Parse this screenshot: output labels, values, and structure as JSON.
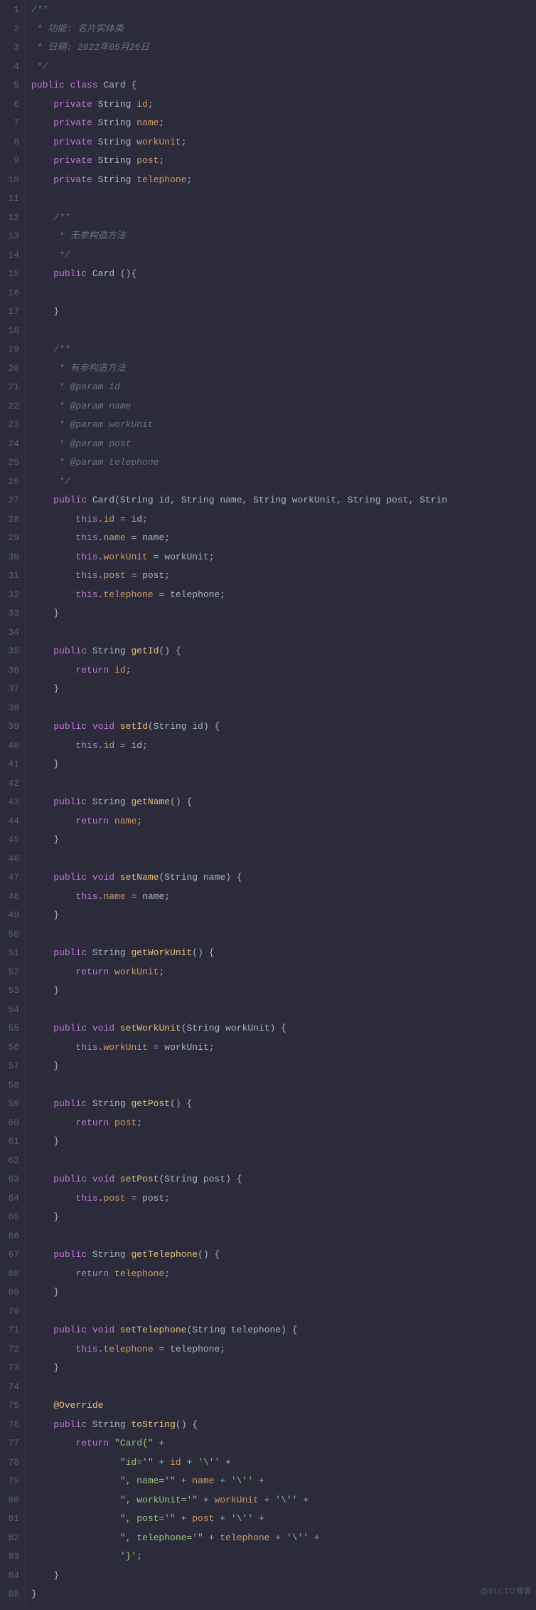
{
  "editor": {
    "gutter_start": 1,
    "gutter_end": 85,
    "watermark": "@51CTO博客",
    "lines": [
      [
        [
          "c",
          "/**"
        ]
      ],
      [
        [
          "c",
          " * 功能: 名片实体类"
        ]
      ],
      [
        [
          "c",
          " * 日期: 2022年05月26日"
        ]
      ],
      [
        [
          "c",
          " */"
        ]
      ],
      [
        [
          "kw",
          "public"
        ],
        [
          "pun",
          " "
        ],
        [
          "kw",
          "class"
        ],
        [
          "pun",
          " "
        ],
        [
          "ty",
          "Card"
        ],
        [
          "pun",
          " {"
        ]
      ],
      [
        [
          "pun",
          "    "
        ],
        [
          "kw",
          "private"
        ],
        [
          "pun",
          " "
        ],
        [
          "ty",
          "String"
        ],
        [
          "pun",
          " "
        ],
        [
          "fld",
          "id"
        ],
        [
          "pun",
          ";"
        ]
      ],
      [
        [
          "pun",
          "    "
        ],
        [
          "kw",
          "private"
        ],
        [
          "pun",
          " "
        ],
        [
          "ty",
          "String"
        ],
        [
          "pun",
          " "
        ],
        [
          "fld",
          "name"
        ],
        [
          "pun",
          ";"
        ]
      ],
      [
        [
          "pun",
          "    "
        ],
        [
          "kw",
          "private"
        ],
        [
          "pun",
          " "
        ],
        [
          "ty",
          "String"
        ],
        [
          "pun",
          " "
        ],
        [
          "fld",
          "workUnit"
        ],
        [
          "pun",
          ";"
        ]
      ],
      [
        [
          "pun",
          "    "
        ],
        [
          "kw",
          "private"
        ],
        [
          "pun",
          " "
        ],
        [
          "ty",
          "String"
        ],
        [
          "pun",
          " "
        ],
        [
          "fld",
          "post"
        ],
        [
          "pun",
          ";"
        ]
      ],
      [
        [
          "pun",
          "    "
        ],
        [
          "kw",
          "private"
        ],
        [
          "pun",
          " "
        ],
        [
          "ty",
          "String"
        ],
        [
          "pun",
          " "
        ],
        [
          "fld",
          "telephone"
        ],
        [
          "pun",
          ";"
        ]
      ],
      [
        [
          "pun",
          ""
        ]
      ],
      [
        [
          "c",
          "    /**"
        ]
      ],
      [
        [
          "c",
          "     * 无参构造方法"
        ]
      ],
      [
        [
          "c",
          "     */"
        ]
      ],
      [
        [
          "pun",
          "    "
        ],
        [
          "kw",
          "public"
        ],
        [
          "pun",
          " "
        ],
        [
          "ty",
          "Card"
        ],
        [
          "pun",
          " (){"
        ]
      ],
      [
        [
          "pun",
          ""
        ]
      ],
      [
        [
          "pun",
          "    }"
        ]
      ],
      [
        [
          "pun",
          ""
        ]
      ],
      [
        [
          "c",
          "    /**"
        ]
      ],
      [
        [
          "c",
          "     * 有参构造方法"
        ]
      ],
      [
        [
          "c",
          "     * @param id"
        ]
      ],
      [
        [
          "c",
          "     * @param name"
        ]
      ],
      [
        [
          "c",
          "     * @param workUnit"
        ]
      ],
      [
        [
          "c",
          "     * @param post"
        ]
      ],
      [
        [
          "c",
          "     * @param telephone"
        ]
      ],
      [
        [
          "c",
          "     */"
        ]
      ],
      [
        [
          "pun",
          "    "
        ],
        [
          "kw",
          "public"
        ],
        [
          "pun",
          " "
        ],
        [
          "ty",
          "Card"
        ],
        [
          "pun",
          "("
        ],
        [
          "ty",
          "String"
        ],
        [
          "pun",
          " id, "
        ],
        [
          "ty",
          "String"
        ],
        [
          "pun",
          " name, "
        ],
        [
          "ty",
          "String"
        ],
        [
          "pun",
          " workUnit, "
        ],
        [
          "ty",
          "String"
        ],
        [
          "pun",
          " post, "
        ],
        [
          "ty",
          "Strin"
        ]
      ],
      [
        [
          "pun",
          "        "
        ],
        [
          "kw",
          "this"
        ],
        [
          "pun",
          "."
        ],
        [
          "fld",
          "id"
        ],
        [
          "pun",
          " = id;"
        ]
      ],
      [
        [
          "pun",
          "        "
        ],
        [
          "kw",
          "this"
        ],
        [
          "pun",
          "."
        ],
        [
          "fld",
          "name"
        ],
        [
          "pun",
          " = name;"
        ]
      ],
      [
        [
          "pun",
          "        "
        ],
        [
          "kw",
          "this"
        ],
        [
          "pun",
          "."
        ],
        [
          "fld",
          "workUnit"
        ],
        [
          "pun",
          " = workUnit;"
        ]
      ],
      [
        [
          "pun",
          "        "
        ],
        [
          "kw",
          "this"
        ],
        [
          "pun",
          "."
        ],
        [
          "fld",
          "post"
        ],
        [
          "pun",
          " = post;"
        ]
      ],
      [
        [
          "pun",
          "        "
        ],
        [
          "kw",
          "this"
        ],
        [
          "pun",
          "."
        ],
        [
          "fld",
          "telephone"
        ],
        [
          "pun",
          " = telephone;"
        ]
      ],
      [
        [
          "pun",
          "    }"
        ]
      ],
      [
        [
          "pun",
          ""
        ]
      ],
      [
        [
          "pun",
          "    "
        ],
        [
          "kw",
          "public"
        ],
        [
          "pun",
          " "
        ],
        [
          "ty",
          "String"
        ],
        [
          "pun",
          " "
        ],
        [
          "fn",
          "getId"
        ],
        [
          "pun",
          "() {"
        ]
      ],
      [
        [
          "pun",
          "        "
        ],
        [
          "kw",
          "return"
        ],
        [
          "pun",
          " "
        ],
        [
          "fld",
          "id"
        ],
        [
          "pun",
          ";"
        ]
      ],
      [
        [
          "pun",
          "    }"
        ]
      ],
      [
        [
          "pun",
          ""
        ]
      ],
      [
        [
          "pun",
          "    "
        ],
        [
          "kw",
          "public"
        ],
        [
          "pun",
          " "
        ],
        [
          "kw",
          "void"
        ],
        [
          "pun",
          " "
        ],
        [
          "fn",
          "setId"
        ],
        [
          "pun",
          "("
        ],
        [
          "ty",
          "String"
        ],
        [
          "pun",
          " id) {"
        ]
      ],
      [
        [
          "pun",
          "        "
        ],
        [
          "kw",
          "this"
        ],
        [
          "pun",
          "."
        ],
        [
          "fld",
          "id"
        ],
        [
          "pun",
          " = id;"
        ]
      ],
      [
        [
          "pun",
          "    }"
        ]
      ],
      [
        [
          "pun",
          ""
        ]
      ],
      [
        [
          "pun",
          "    "
        ],
        [
          "kw",
          "public"
        ],
        [
          "pun",
          " "
        ],
        [
          "ty",
          "String"
        ],
        [
          "pun",
          " "
        ],
        [
          "fn",
          "getName"
        ],
        [
          "pun",
          "() {"
        ]
      ],
      [
        [
          "pun",
          "        "
        ],
        [
          "kw",
          "return"
        ],
        [
          "pun",
          " "
        ],
        [
          "fld",
          "name"
        ],
        [
          "pun",
          ";"
        ]
      ],
      [
        [
          "pun",
          "    }"
        ]
      ],
      [
        [
          "pun",
          ""
        ]
      ],
      [
        [
          "pun",
          "    "
        ],
        [
          "kw",
          "public"
        ],
        [
          "pun",
          " "
        ],
        [
          "kw",
          "void"
        ],
        [
          "pun",
          " "
        ],
        [
          "fn",
          "setName"
        ],
        [
          "pun",
          "("
        ],
        [
          "ty",
          "String"
        ],
        [
          "pun",
          " name) {"
        ]
      ],
      [
        [
          "pun",
          "        "
        ],
        [
          "kw",
          "this"
        ],
        [
          "pun",
          "."
        ],
        [
          "fld",
          "name"
        ],
        [
          "pun",
          " = name;"
        ]
      ],
      [
        [
          "pun",
          "    }"
        ]
      ],
      [
        [
          "pun",
          ""
        ]
      ],
      [
        [
          "pun",
          "    "
        ],
        [
          "kw",
          "public"
        ],
        [
          "pun",
          " "
        ],
        [
          "ty",
          "String"
        ],
        [
          "pun",
          " "
        ],
        [
          "fn",
          "getWorkUnit"
        ],
        [
          "pun",
          "() {"
        ]
      ],
      [
        [
          "pun",
          "        "
        ],
        [
          "kw",
          "return"
        ],
        [
          "pun",
          " "
        ],
        [
          "fld",
          "workUnit"
        ],
        [
          "pun",
          ";"
        ]
      ],
      [
        [
          "pun",
          "    }"
        ]
      ],
      [
        [
          "pun",
          ""
        ]
      ],
      [
        [
          "pun",
          "    "
        ],
        [
          "kw",
          "public"
        ],
        [
          "pun",
          " "
        ],
        [
          "kw",
          "void"
        ],
        [
          "pun",
          " "
        ],
        [
          "fn",
          "setWorkUnit"
        ],
        [
          "pun",
          "("
        ],
        [
          "ty",
          "String"
        ],
        [
          "pun",
          " workUnit) {"
        ]
      ],
      [
        [
          "pun",
          "        "
        ],
        [
          "kw",
          "this"
        ],
        [
          "pun",
          "."
        ],
        [
          "fld",
          "workUnit"
        ],
        [
          "pun",
          " = workUnit;"
        ]
      ],
      [
        [
          "pun",
          "    }"
        ]
      ],
      [
        [
          "pun",
          ""
        ]
      ],
      [
        [
          "pun",
          "    "
        ],
        [
          "kw",
          "public"
        ],
        [
          "pun",
          " "
        ],
        [
          "ty",
          "String"
        ],
        [
          "pun",
          " "
        ],
        [
          "fn",
          "getPost"
        ],
        [
          "pun",
          "() {"
        ]
      ],
      [
        [
          "pun",
          "        "
        ],
        [
          "kw",
          "return"
        ],
        [
          "pun",
          " "
        ],
        [
          "fld",
          "post"
        ],
        [
          "pun",
          ";"
        ]
      ],
      [
        [
          "pun",
          "    }"
        ]
      ],
      [
        [
          "pun",
          ""
        ]
      ],
      [
        [
          "pun",
          "    "
        ],
        [
          "kw",
          "public"
        ],
        [
          "pun",
          " "
        ],
        [
          "kw",
          "void"
        ],
        [
          "pun",
          " "
        ],
        [
          "fn",
          "setPost"
        ],
        [
          "pun",
          "("
        ],
        [
          "ty",
          "String"
        ],
        [
          "pun",
          " post) {"
        ]
      ],
      [
        [
          "pun",
          "        "
        ],
        [
          "kw",
          "this"
        ],
        [
          "pun",
          "."
        ],
        [
          "fld",
          "post"
        ],
        [
          "pun",
          " = post;"
        ]
      ],
      [
        [
          "pun",
          "    }"
        ]
      ],
      [
        [
          "pun",
          ""
        ]
      ],
      [
        [
          "pun",
          "    "
        ],
        [
          "kw",
          "public"
        ],
        [
          "pun",
          " "
        ],
        [
          "ty",
          "String"
        ],
        [
          "pun",
          " "
        ],
        [
          "fn",
          "getTelephone"
        ],
        [
          "pun",
          "() {"
        ]
      ],
      [
        [
          "pun",
          "        "
        ],
        [
          "kw",
          "return"
        ],
        [
          "pun",
          " "
        ],
        [
          "fld",
          "telephone"
        ],
        [
          "pun",
          ";"
        ]
      ],
      [
        [
          "pun",
          "    }"
        ]
      ],
      [
        [
          "pun",
          ""
        ]
      ],
      [
        [
          "pun",
          "    "
        ],
        [
          "kw",
          "public"
        ],
        [
          "pun",
          " "
        ],
        [
          "kw",
          "void"
        ],
        [
          "pun",
          " "
        ],
        [
          "fn",
          "setTelephone"
        ],
        [
          "pun",
          "("
        ],
        [
          "ty",
          "String"
        ],
        [
          "pun",
          " telephone) {"
        ]
      ],
      [
        [
          "pun",
          "        "
        ],
        [
          "kw",
          "this"
        ],
        [
          "pun",
          "."
        ],
        [
          "fld",
          "telephone"
        ],
        [
          "pun",
          " = telephone;"
        ]
      ],
      [
        [
          "pun",
          "    }"
        ]
      ],
      [
        [
          "pun",
          ""
        ]
      ],
      [
        [
          "pun",
          "    "
        ],
        [
          "ann",
          "@Override"
        ]
      ],
      [
        [
          "pun",
          "    "
        ],
        [
          "kw",
          "public"
        ],
        [
          "pun",
          " "
        ],
        [
          "ty",
          "String"
        ],
        [
          "pun",
          " "
        ],
        [
          "fn",
          "toString"
        ],
        [
          "pun",
          "() {"
        ]
      ],
      [
        [
          "pun",
          "        "
        ],
        [
          "kw",
          "return"
        ],
        [
          "pun",
          " "
        ],
        [
          "str",
          "\"Card{\""
        ],
        [
          "pun",
          " +"
        ]
      ],
      [
        [
          "pun",
          "                "
        ],
        [
          "str",
          "\"id='\""
        ],
        [
          "pun",
          " + "
        ],
        [
          "fld",
          "id"
        ],
        [
          "pun",
          " + "
        ],
        [
          "str",
          "'\\''"
        ],
        [
          "pun",
          " +"
        ]
      ],
      [
        [
          "pun",
          "                "
        ],
        [
          "str",
          "\", name='\""
        ],
        [
          "pun",
          " + "
        ],
        [
          "fld",
          "name"
        ],
        [
          "pun",
          " + "
        ],
        [
          "str",
          "'\\''"
        ],
        [
          "pun",
          " +"
        ]
      ],
      [
        [
          "pun",
          "                "
        ],
        [
          "str",
          "\", workUnit='\""
        ],
        [
          "pun",
          " + "
        ],
        [
          "fld",
          "workUnit"
        ],
        [
          "pun",
          " + "
        ],
        [
          "str",
          "'\\''"
        ],
        [
          "pun",
          " +"
        ]
      ],
      [
        [
          "pun",
          "                "
        ],
        [
          "str",
          "\", post='\""
        ],
        [
          "pun",
          " + "
        ],
        [
          "fld",
          "post"
        ],
        [
          "pun",
          " + "
        ],
        [
          "str",
          "'\\''"
        ],
        [
          "pun",
          " +"
        ]
      ],
      [
        [
          "pun",
          "                "
        ],
        [
          "str",
          "\", telephone='\""
        ],
        [
          "pun",
          " + "
        ],
        [
          "fld",
          "telephone"
        ],
        [
          "pun",
          " + "
        ],
        [
          "str",
          "'\\''"
        ],
        [
          "pun",
          " +"
        ]
      ],
      [
        [
          "pun",
          "                "
        ],
        [
          "str",
          "'}'"
        ],
        [
          "pun",
          ";"
        ]
      ],
      [
        [
          "pun",
          "    }"
        ]
      ],
      [
        [
          "pun",
          "}"
        ]
      ]
    ]
  }
}
